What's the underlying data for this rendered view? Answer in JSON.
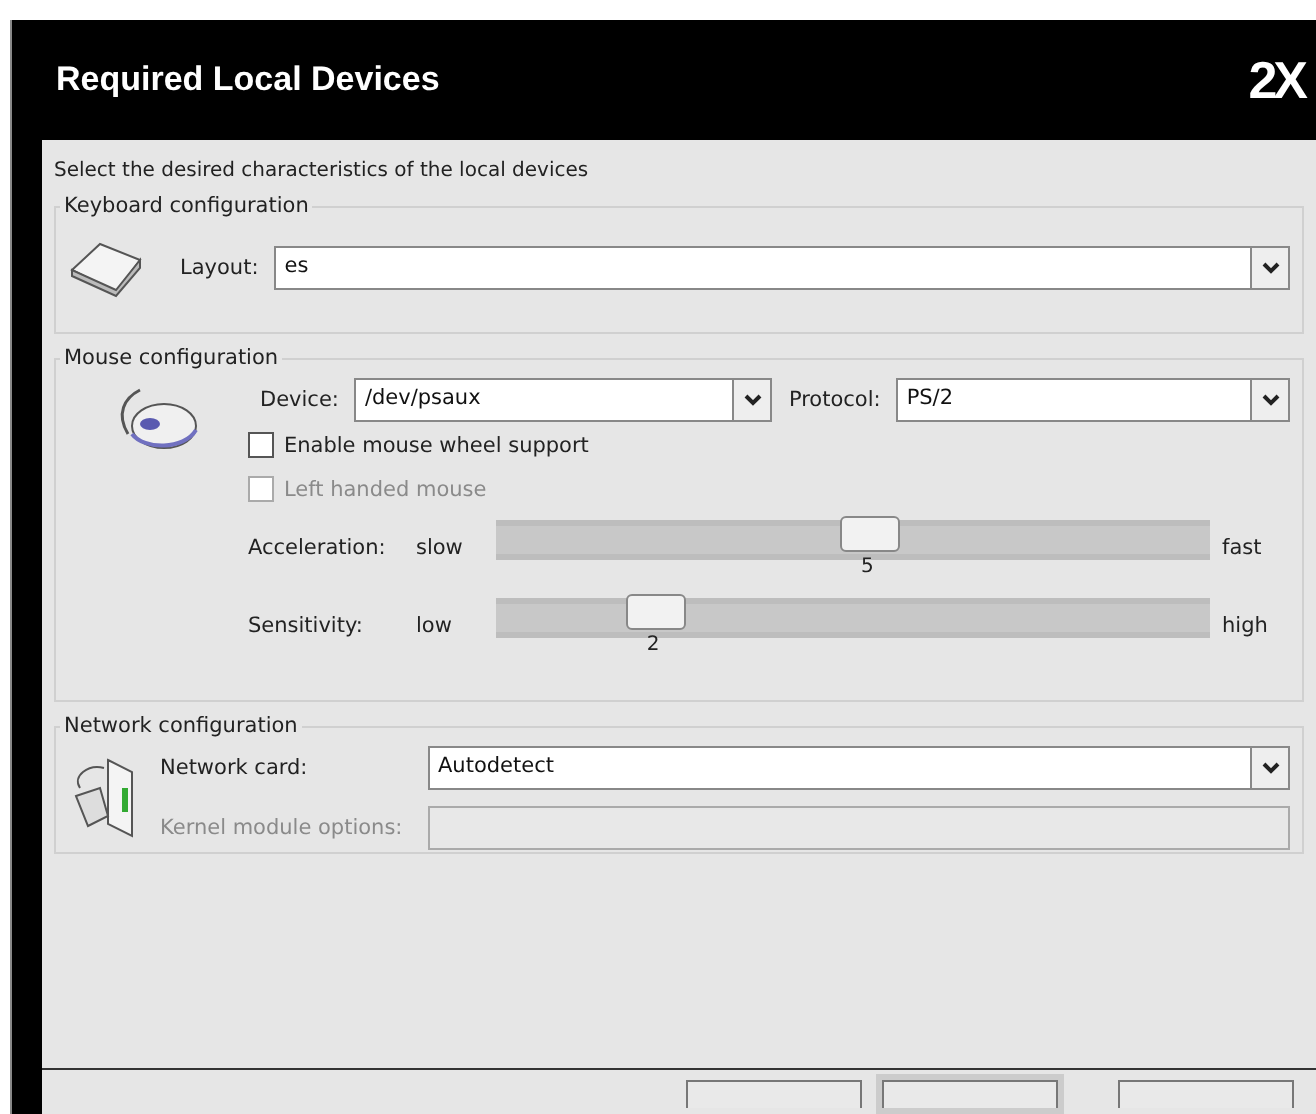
{
  "header": {
    "title": "Required Local Devices",
    "logo": "2X"
  },
  "intro": "Select the desired characteristics of the local devices",
  "keyboard": {
    "legend": "Keyboard configuration",
    "layout_label": "Layout:",
    "layout_value": "es"
  },
  "mouse": {
    "legend": "Mouse configuration",
    "device_label": "Device:",
    "device_value": "/dev/psaux",
    "protocol_label": "Protocol:",
    "protocol_value": "PS/2",
    "checkboxes": [
      {
        "label": "Enable mouse wheel support",
        "checked": false,
        "disabled": false
      },
      {
        "label": "Left handed mouse",
        "checked": false,
        "disabled": true
      }
    ],
    "sliders": [
      {
        "label": "Acceleration:",
        "min_label": "slow",
        "max_label": "fast",
        "value": "5",
        "level": 0.52
      },
      {
        "label": "Sensitivity:",
        "min_label": "low",
        "max_label": "high",
        "value": "2",
        "level": 0.22
      }
    ]
  },
  "network": {
    "legend": "Network configuration",
    "card_label": "Network card:",
    "card_value": "Autodetect",
    "options_label": "Kernel module options:",
    "options_disabled": true
  },
  "buttons": [
    {
      "kind": "plain"
    },
    {
      "kind": "default"
    },
    {
      "kind": "plain"
    }
  ]
}
